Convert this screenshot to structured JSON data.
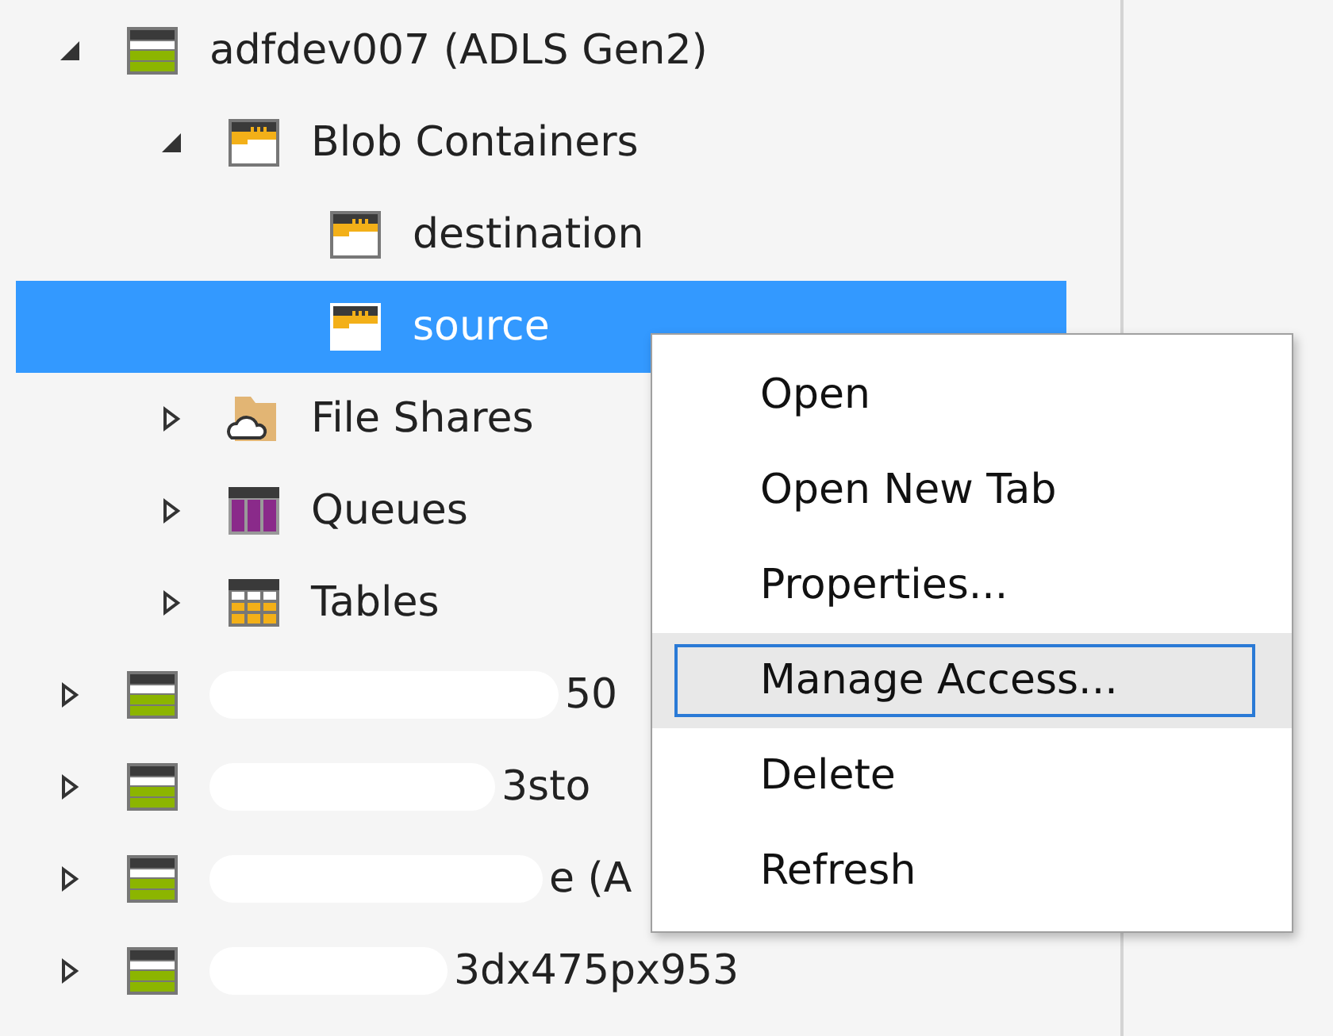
{
  "tree": [
    {
      "label": "adfdev007 (ADLS Gen2)",
      "kind": "account",
      "expanded": true,
      "selected": false,
      "children": [
        {
          "label": "Blob Containers",
          "kind": "blobs",
          "expanded": true,
          "selected": false,
          "children": [
            {
              "label": "destination",
              "kind": "container",
              "selected": false
            },
            {
              "label": "source",
              "kind": "container",
              "selected": true
            }
          ]
        },
        {
          "label": "File Shares",
          "kind": "fileshares",
          "expanded": false,
          "selected": false
        },
        {
          "label": "Queues",
          "kind": "queues",
          "expanded": false,
          "selected": false
        },
        {
          "label": "Tables",
          "kind": "tables",
          "expanded": false,
          "selected": false
        }
      ]
    },
    {
      "label": "50",
      "kind": "account",
      "expanded": false,
      "selected": false,
      "redacted": true
    },
    {
      "label": "3sto",
      "kind": "account",
      "expanded": false,
      "selected": false,
      "redacted": true
    },
    {
      "label": "e (A",
      "kind": "account",
      "expanded": false,
      "selected": false,
      "redacted": true
    },
    {
      "label": "3dx475px953",
      "kind": "account",
      "expanded": false,
      "selected": false,
      "redacted": true
    }
  ],
  "context_menu": {
    "items": [
      {
        "label": "Open",
        "selected": false
      },
      {
        "label": "Open New Tab",
        "selected": false
      },
      {
        "label": "Properties...",
        "selected": false
      },
      {
        "label": "Manage Access...",
        "selected": true
      },
      {
        "label": "Delete",
        "selected": false
      },
      {
        "label": "Refresh",
        "selected": false
      }
    ]
  }
}
